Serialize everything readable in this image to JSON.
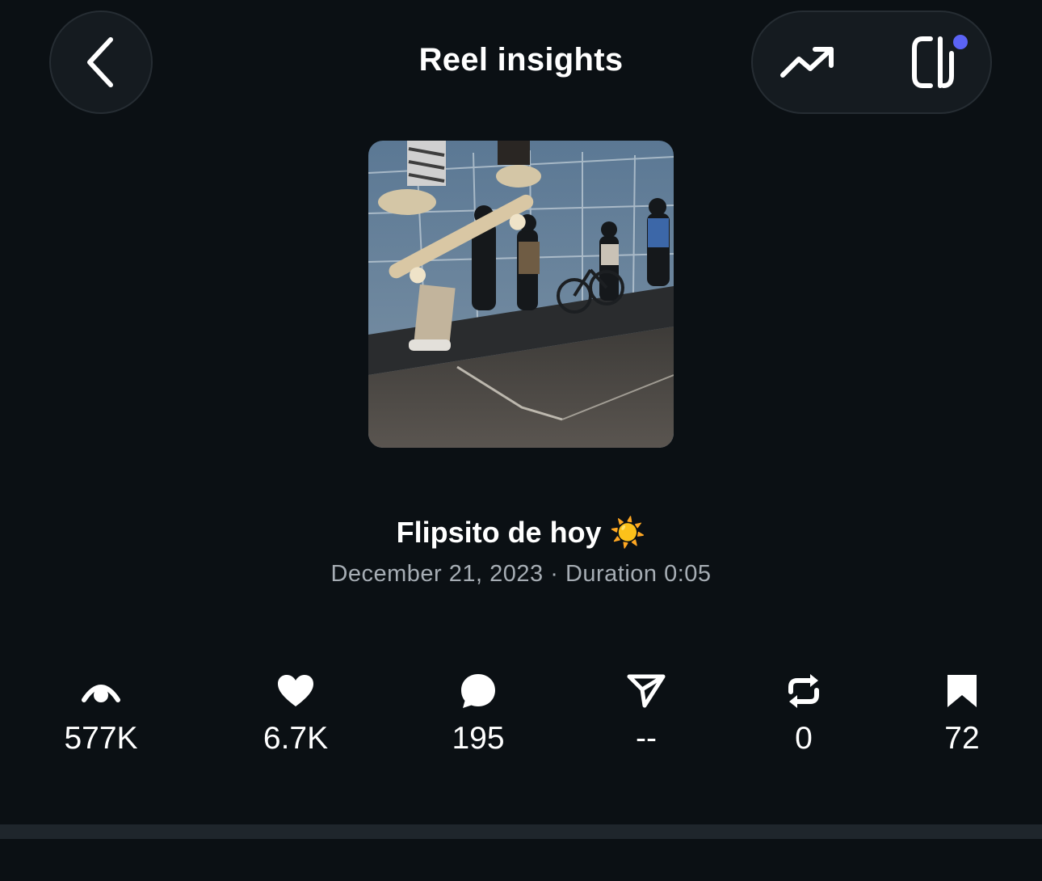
{
  "header": {
    "title": "Reel insights"
  },
  "post": {
    "caption": "Flipsito de hoy ☀️",
    "date": "December 21, 2023",
    "separator": " · ",
    "duration": "Duration 0:05"
  },
  "stats": [
    {
      "icon": "eye-icon",
      "value": "577K"
    },
    {
      "icon": "heart-icon",
      "value": "6.7K"
    },
    {
      "icon": "comment-icon",
      "value": "195"
    },
    {
      "icon": "share-icon",
      "value": "--"
    },
    {
      "icon": "repost-icon",
      "value": "0"
    },
    {
      "icon": "bookmark-icon",
      "value": "72"
    }
  ],
  "colors": {
    "background": "#0b1014",
    "notification_dot": "#5b63f5",
    "secondary_text": "#a6adb4"
  }
}
